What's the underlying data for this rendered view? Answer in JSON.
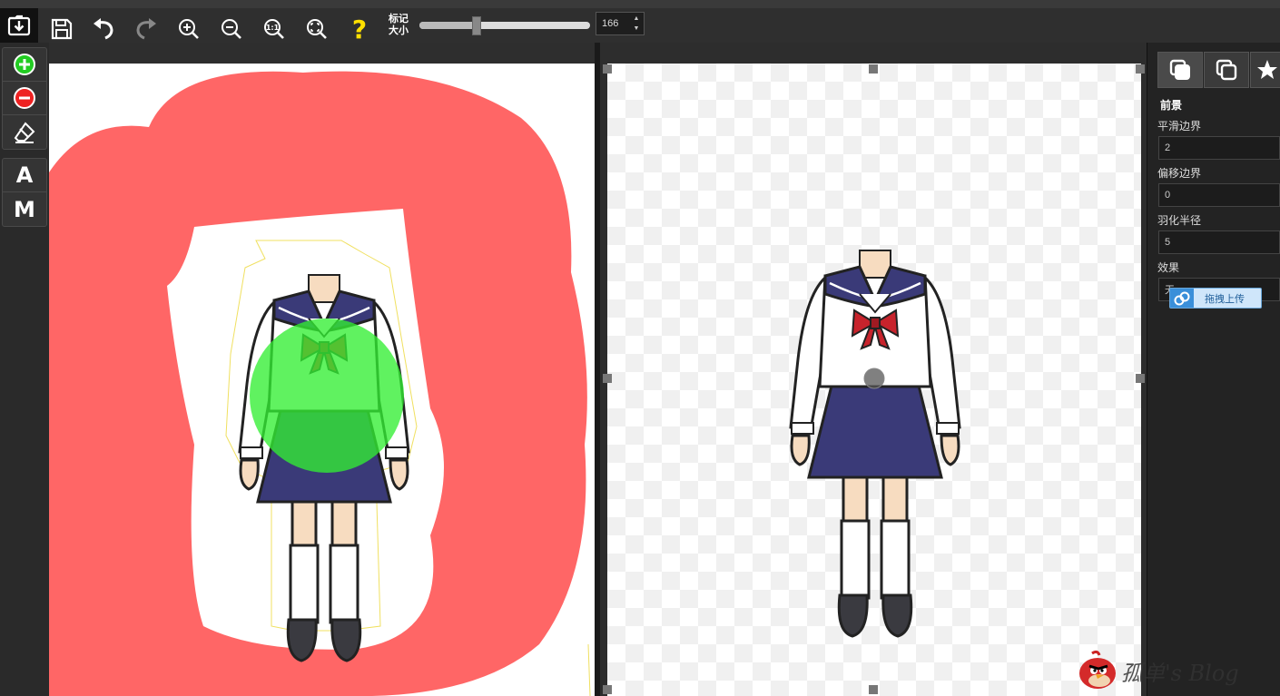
{
  "toolbar": {
    "mark_size_label": "标记大小",
    "mark_size_value": "166",
    "slider_fraction": 0.33,
    "help_glyph": "?",
    "icons": [
      "open-file-icon",
      "save-icon",
      "undo-icon",
      "redo-icon",
      "zoom-in-icon",
      "zoom-out-icon",
      "actual-size-icon",
      "fit-screen-icon",
      "help-icon"
    ]
  },
  "left_tools": {
    "add_icon": "plus-circle-icon",
    "remove_icon": "minus-circle-icon",
    "eraser_icon": "eraser-icon",
    "auto_label": "A",
    "manual_label": "M"
  },
  "side_panel": {
    "section_title": "前景",
    "smooth_label": "平滑边界",
    "smooth_value": "2",
    "offset_label": "偏移边界",
    "offset_value": "0",
    "feather_label": "羽化半径",
    "feather_value": "5",
    "effect_label": "效果",
    "effect_value": "无"
  },
  "upload_button": {
    "label": "拖拽上传"
  },
  "watermark": {
    "text": "孤单's Blog"
  },
  "colors": {
    "red_mark": "#ff6666",
    "green_mark": "#33ee33",
    "navy": "#3a3a78",
    "accent_yellow": "#ffe000"
  }
}
